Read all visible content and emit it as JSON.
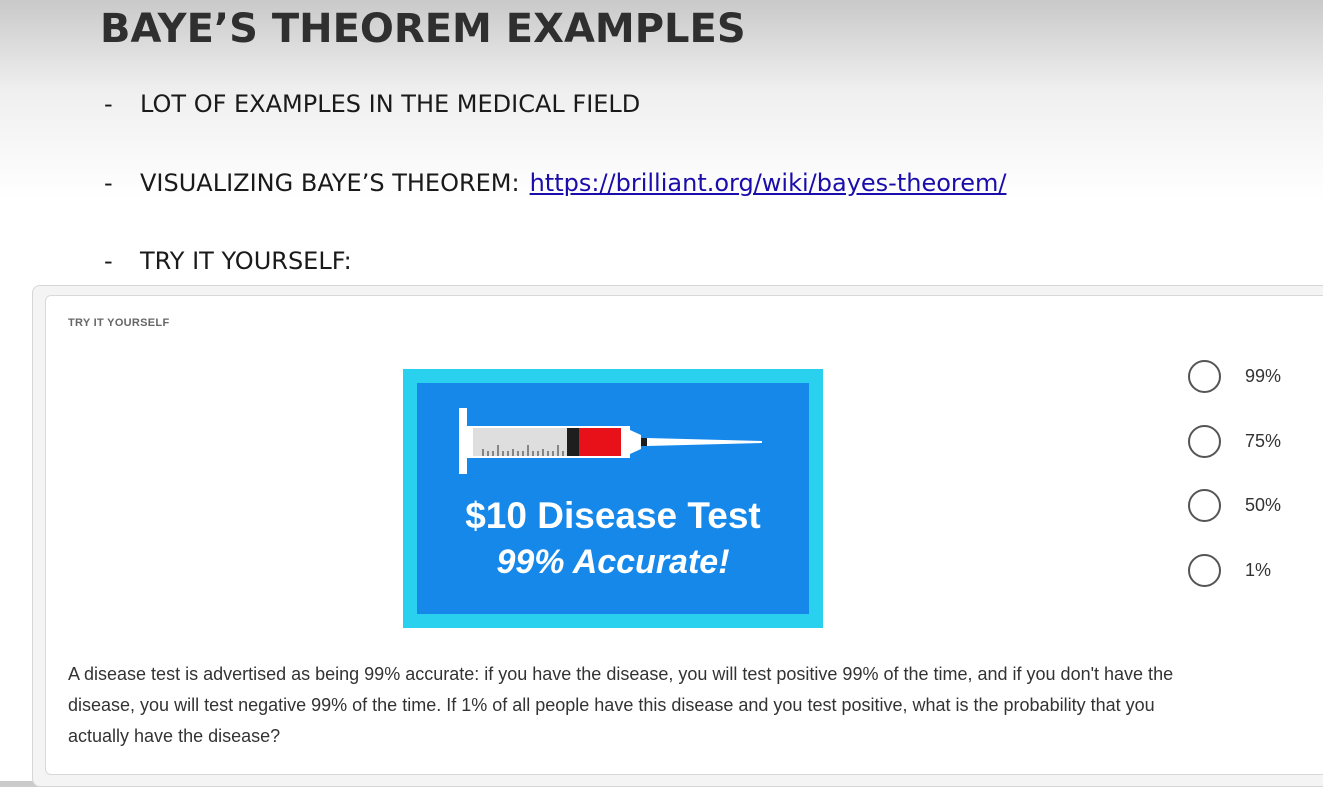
{
  "slide": {
    "title": "BAYE’S THEOREM EXAMPLES",
    "bullets": [
      {
        "dash": "-",
        "text": "LOT OF EXAMPLES IN THE MEDICAL FIELD"
      },
      {
        "dash": "-",
        "text": "VISUALIZING BAYE’S THEOREM:",
        "link": "https://brilliant.org/wiki/bayes-theorem/"
      },
      {
        "dash": "-",
        "text": "TRY IT YOURSELF:"
      }
    ]
  },
  "problem": {
    "label": "TRY IT YOURSELF",
    "image": {
      "icon": "syringe-icon",
      "title": "$10 Disease Test",
      "subtitle": "99% Accurate!"
    },
    "options": [
      {
        "label": "99%"
      },
      {
        "label": "75%"
      },
      {
        "label": "50%"
      },
      {
        "label": "1%"
      }
    ],
    "question": "A disease test is advertised as being 99% accurate: if you have the disease, you will test positive 99% of the time, and if you don't have the disease, you will test negative 99% of the time. If 1% of all people have this disease and you test positive, what is the probability that you actually have the disease?"
  },
  "colors": {
    "ad_border": "#2ad1ef",
    "ad_background": "#1588ea",
    "syringe_fluid": "#e8111a",
    "link": "#1a0dab"
  }
}
